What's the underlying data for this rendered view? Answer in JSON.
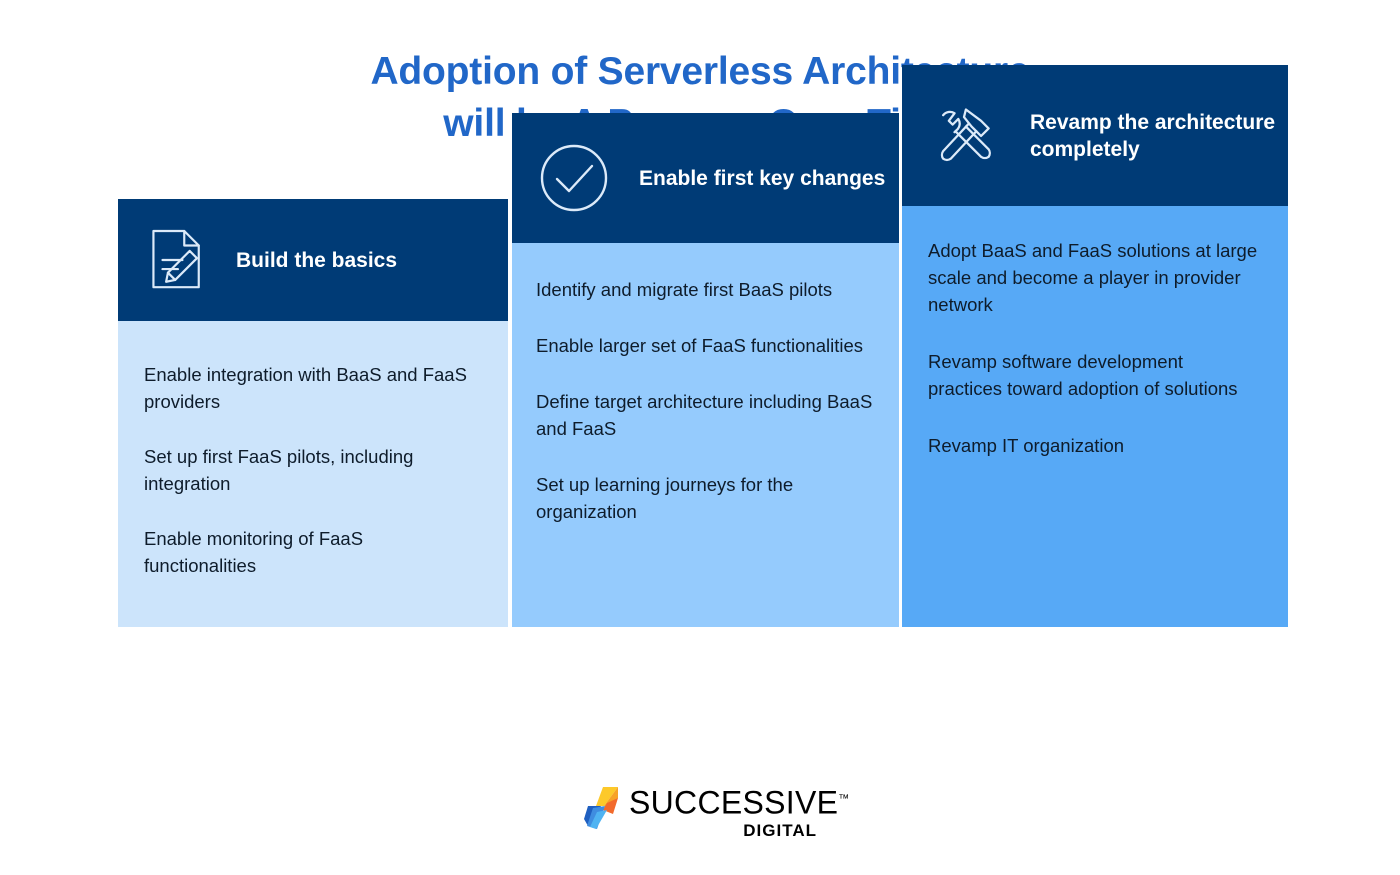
{
  "title": {
    "line1": "Adoption of Serverless Architecture",
    "line2": "will be A Process Over Time",
    "color": "#2167c8"
  },
  "colors": {
    "header_navy": "#003b76",
    "stage1_body": "#cce4fb",
    "stage2_body": "#95cbfd",
    "stage3_body": "#57a9f6",
    "body_text": "#0e1c2b",
    "header_text": "#ffffff",
    "logo_yellow": "#fdc92a",
    "logo_orange": "#f26a2c",
    "logo_blue_dark": "#1f5fc0",
    "logo_blue_light": "#4fb3f2"
  },
  "chart_data": {
    "type": "bar",
    "title": "Adoption of Serverless Architecture will be A Process Over Time",
    "categories": [
      "Build the basics",
      "Enable first key changes",
      "Revamp the architecture completely"
    ],
    "values": [
      1,
      2,
      3
    ],
    "xlabel": "",
    "ylabel": "",
    "grid": false,
    "legend": "none"
  },
  "stages": [
    {
      "id": "stage-1",
      "icon": "document-pencil-icon",
      "heading": "Build the basics",
      "items": [
        "Enable integration with BaaS and FaaS providers",
        "Set up first FaaS pilots, including integration",
        "Enable monitoring of FaaS functionalities"
      ]
    },
    {
      "id": "stage-2",
      "icon": "check-circle-icon",
      "heading": "Enable first key changes",
      "items": [
        "Identify and migrate first BaaS pilots",
        "Enable larger set of FaaS functionalities",
        "Define target architecture including BaaS and FaaS",
        "Set up learning journeys for the organization"
      ]
    },
    {
      "id": "stage-3",
      "icon": "hammer-wrench-icon",
      "heading": "Revamp the architecture completely",
      "items": [
        "Adopt BaaS and FaaS solutions at large scale and become a player in provider network",
        "Revamp software development practices toward adoption of solutions",
        "Revamp IT organization"
      ]
    }
  ],
  "logo": {
    "name": "SUCCESSIVE",
    "trademark": "™",
    "subtitle": "DIGITAL"
  }
}
